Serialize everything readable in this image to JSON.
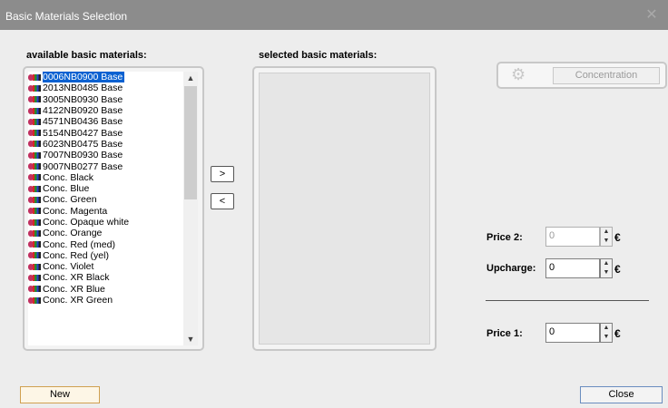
{
  "window": {
    "title": "Basic Materials Selection",
    "close_glyph": "✕"
  },
  "available": {
    "label": "available basic materials:",
    "items": [
      "0006NB0900 Base",
      "2013NB0485 Base",
      "3005NB0930 Base",
      "4122NB0920 Base",
      "4571NB0436 Base",
      "5154NB0427 Base",
      "6023NB0475 Base",
      "7007NB0930 Base",
      "9007NB0277 Base",
      "Conc. Black",
      "Conc. Blue",
      "Conc. Green",
      "Conc. Magenta",
      "Conc. Opaque white",
      "Conc. Orange",
      "Conc. Red (med)",
      "Conc. Red (yel)",
      "Conc. Violet",
      "Conc. XR Black",
      "Conc. XR Blue",
      "Conc. XR Green"
    ],
    "selected_index": 0
  },
  "transfer": {
    "add_label": ">",
    "remove_label": "<"
  },
  "selected": {
    "label": "selected basic materials:"
  },
  "concentration": {
    "label": "Concentration",
    "icon": "gear-icon"
  },
  "pricing": {
    "price2_label": "Price 2:",
    "price2_value": "0",
    "upcharge_label": "Upcharge:",
    "upcharge_value": "0",
    "price1_label": "Price 1:",
    "price1_value": "0",
    "currency": "€"
  },
  "footer": {
    "new_label": "New",
    "close_label": "Close"
  }
}
